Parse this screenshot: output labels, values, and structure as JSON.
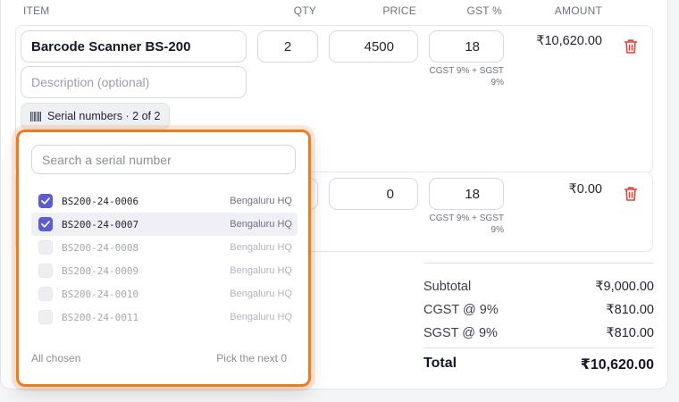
{
  "table_header": {
    "item": "ITEM",
    "qty": "QTY",
    "price": "PRICE",
    "gst": "GST %",
    "amount": "AMOUNT"
  },
  "rows": [
    {
      "name": "Barcode Scanner BS-200",
      "description_placeholder": "Description (optional)",
      "qty": "2",
      "price": "4500",
      "gst": "18",
      "gst_note_line1": "CGST 9% + SGST",
      "gst_note_line2": "9%",
      "amount": "₹10,620.00",
      "serial_button_label": "Serial numbers · 2 of 2"
    },
    {
      "price": "0",
      "gst": "18",
      "gst_note_line1": "CGST 9% + SGST",
      "gst_note_line2": "9%",
      "amount": "₹0.00"
    }
  ],
  "serial_popup": {
    "search_placeholder": "Search a serial number",
    "serials": [
      {
        "serial": "BS200-24-0006",
        "location": "Bengaluru HQ",
        "checked": true
      },
      {
        "serial": "BS200-24-0007",
        "location": "Bengaluru HQ",
        "checked": true
      },
      {
        "serial": "BS200-24-0008",
        "location": "Bengaluru HQ",
        "checked": false
      },
      {
        "serial": "BS200-24-0009",
        "location": "Bengaluru HQ",
        "checked": false
      },
      {
        "serial": "BS200-24-0010",
        "location": "Bengaluru HQ",
        "checked": false
      },
      {
        "serial": "BS200-24-0011",
        "location": "Bengaluru HQ",
        "checked": false
      }
    ],
    "footer_left": "All chosen",
    "footer_right": "Pick the next 0"
  },
  "totals": {
    "subtotal_label": "Subtotal",
    "subtotal_value": "₹9,000.00",
    "cgst_label": "CGST @ 9%",
    "cgst_value": "₹810.00",
    "sgst_label": "SGST @ 9%",
    "sgst_value": "₹810.00",
    "total_label": "Total",
    "total_value": "₹10,620.00"
  },
  "colors": {
    "accent_orange": "#f07a1f",
    "checkbox_purple": "#5b5bd6",
    "delete_red": "#e0443a"
  },
  "icons": {
    "delete": "trash-icon",
    "serial": "barcode-icon",
    "check": "check-icon"
  }
}
